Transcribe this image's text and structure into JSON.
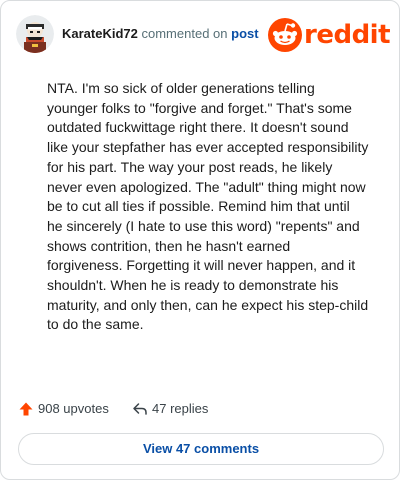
{
  "comment": {
    "username": "KarateKid72",
    "action_text": "commented on",
    "post_link": "post",
    "body": "NTA. I'm so sick of older generations telling younger folks to \"forgive and forget.\" That's some outdated fuckwittage right there. It doesn't sound like your stepfather has ever accepted responsibility for his part. The way your post reads, he likely never even apologized. The \"adult\" thing might now be to cut all ties if possible. Remind him that until he sincerely (I hate to use this word) \"repents\" and shows contrition, then he hasn't earned forgiveness. Forgetting it will never happen, and it shouldn't. When he is ready to demonstrate his maturity, and only then, can he expect his step-child to do the same."
  },
  "brand": {
    "wordmark": "reddit",
    "color": "#ff4500",
    "icon": "reddit-snoo-icon"
  },
  "stats": {
    "upvotes": "908 upvotes",
    "upvote_icon": "upvote-arrow-icon",
    "upvote_color": "#ff4500",
    "replies": "47 replies",
    "reply_icon": "reply-arrow-icon"
  },
  "view_comments_label": "View 47 comments",
  "colors": {
    "link": "#0a4fa6",
    "muted": "#576f76",
    "border": "#d9dcde"
  }
}
